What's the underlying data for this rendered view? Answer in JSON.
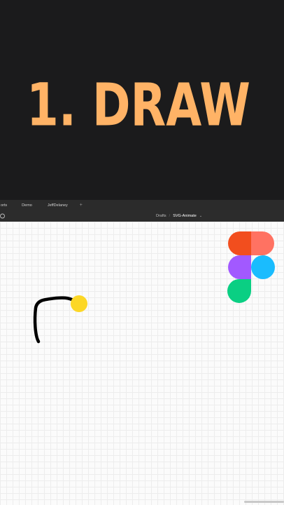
{
  "banner": {
    "title": "1. DRAW",
    "color": "#ffb366"
  },
  "tabs": [
    {
      "label": "orts"
    },
    {
      "label": "Demo"
    },
    {
      "label": "JeffDelaney"
    },
    {
      "label": "+"
    }
  ],
  "toolbar": {
    "left_icon": "circle-icon",
    "breadcrumb": {
      "folder": "Drafts",
      "separator": "/",
      "file": "SVG-Animate",
      "chevron": "⌄"
    }
  },
  "canvas": {
    "stroke_color": "#000000",
    "cursor_dot_color": "#fcd726",
    "logo": "figma-logo",
    "logo_colors": [
      "#f24e1e",
      "#ff7262",
      "#a259ff",
      "#1abcfe",
      "#0acf83"
    ]
  }
}
